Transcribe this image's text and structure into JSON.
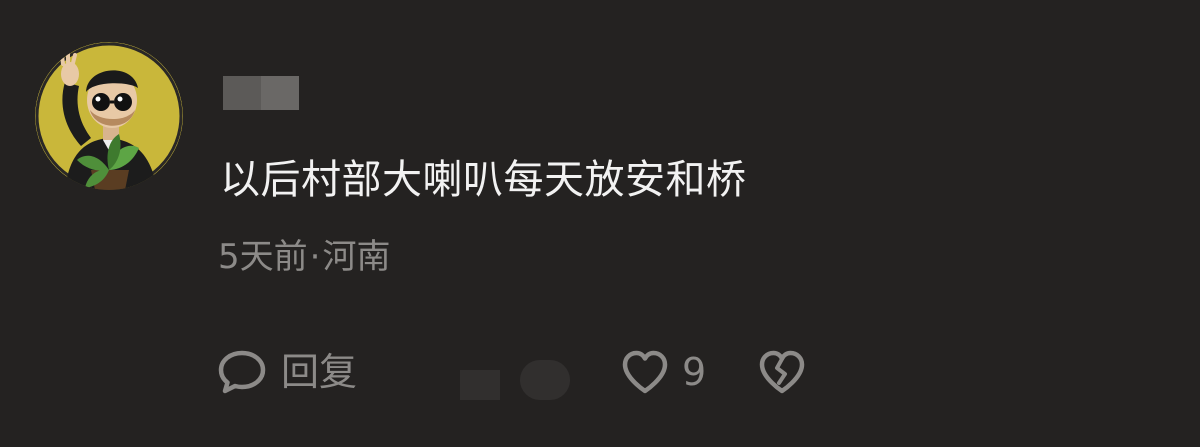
{
  "comment": {
    "avatar": {
      "icon": "cartoon-man-avatar-icon",
      "background_color": "#c9b73a"
    },
    "username": {
      "redacted": true
    },
    "text": "以后村部大喇叭每天放安和桥",
    "meta": {
      "time": "5天前",
      "separator": "·",
      "location": "河南"
    },
    "actions": {
      "reply": {
        "icon": "speech-bubble-icon",
        "label": "回复"
      },
      "like": {
        "icon": "heart-icon",
        "count": "9"
      },
      "dislike": {
        "icon": "broken-heart-icon"
      }
    }
  },
  "colors": {
    "background": "#242221",
    "text_primary": "#f2f2f2",
    "text_secondary": "#8c8a88"
  }
}
